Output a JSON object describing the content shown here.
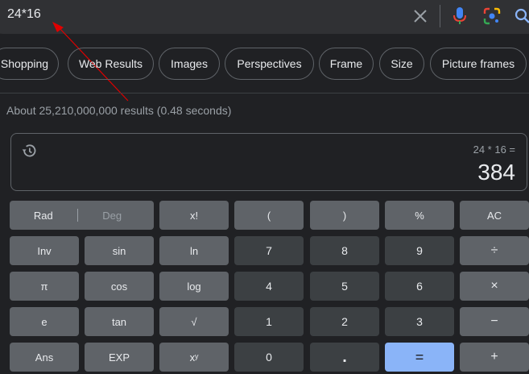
{
  "search": {
    "query": "24*16"
  },
  "chips": [
    "Shopping",
    "Web Results",
    "Images",
    "Perspectives",
    "Frame",
    "Size",
    "Picture frames"
  ],
  "results_text": "About 25,210,000,000 results (0.48 seconds)",
  "calculator": {
    "expression": "24 * 16 =",
    "result": "384",
    "rad_label": "Rad",
    "deg_label": "Deg",
    "keys": [
      [
        "x!",
        "(",
        ")",
        "%",
        "AC"
      ],
      [
        "Inv",
        "sin",
        "ln",
        "7",
        "8",
        "9",
        "÷"
      ],
      [
        "π",
        "cos",
        "log",
        "4",
        "5",
        "6",
        "×"
      ],
      [
        "e",
        "tan",
        "√",
        "1",
        "2",
        "3",
        "−"
      ],
      [
        "Ans",
        "EXP",
        "xʸ",
        "0",
        ".",
        "=",
        "+"
      ]
    ]
  },
  "colors": {
    "background": "#202124",
    "key_function": "#5f6368",
    "key_number": "#3c4043",
    "key_equals": "#8ab4f8",
    "annotation_arrow": "#e00000"
  }
}
